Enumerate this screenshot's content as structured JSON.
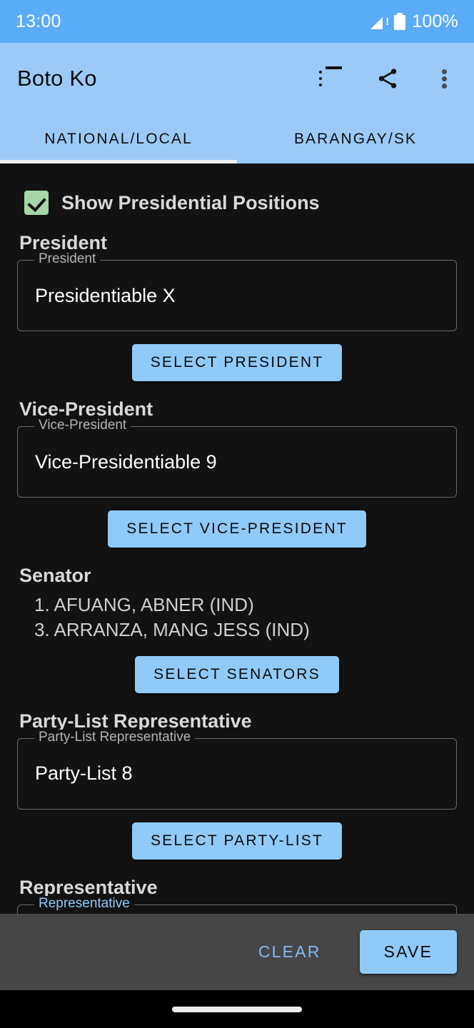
{
  "status_bar": {
    "time": "13:00",
    "battery": "100%",
    "signal_icon": "signal-no-sim-icon",
    "battery_icon": "battery-full-icon",
    "bg_color": "#5BACF7"
  },
  "app_bar": {
    "title": "Boto Ko",
    "bg_color": "#9CCAF8",
    "actions": [
      {
        "name": "list-icon",
        "label": "List"
      },
      {
        "name": "share-icon",
        "label": "Share"
      },
      {
        "name": "overflow-menu-icon",
        "label": "More options"
      }
    ]
  },
  "tabs": {
    "items": [
      {
        "label": "NATIONAL/LOCAL",
        "selected": true
      },
      {
        "label": "BARANGAY/SK",
        "selected": false
      }
    ],
    "indicator_color": "#F2F2F2"
  },
  "checkbox": {
    "label": "Show Presidential Positions",
    "checked": true,
    "color": "#A5D6A7"
  },
  "sections": {
    "president": {
      "title": "President",
      "field_label": "President",
      "field_value": "Presidentiable X",
      "button": "SELECT PRESIDENT"
    },
    "vice_president": {
      "title": "Vice-President",
      "field_label": "Vice-President",
      "field_value": "Vice-Presidentiable 9",
      "button": "SELECT VICE-PRESIDENT"
    },
    "senator": {
      "title": "Senator",
      "items": [
        "1. AFUANG, ABNER (IND)",
        "3. ARRANZA, MANG JESS (IND)"
      ],
      "button": "SELECT SENATORS"
    },
    "party_list": {
      "title": "Party-List Representative",
      "field_label": "Party-List Representative",
      "field_value": "Party-List 8",
      "button": "SELECT PARTY-LIST"
    },
    "representative": {
      "title": "Representative",
      "field_label": "Representative"
    }
  },
  "bottom_bar": {
    "clear_label": "CLEAR",
    "save_label": "SAVE",
    "bg_color": "#464646",
    "accent_color": "#90CAF9"
  },
  "nav_bar": {
    "gesture_pill": "home-gesture-pill"
  }
}
